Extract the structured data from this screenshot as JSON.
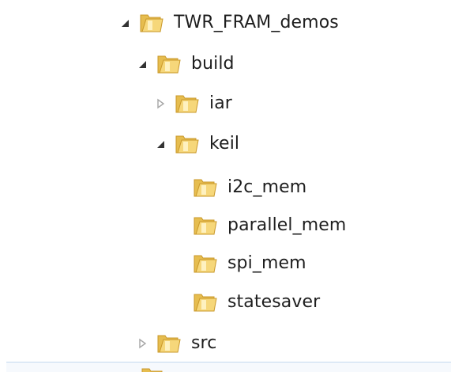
{
  "tree": {
    "nodes": [
      {
        "label": "TWR_FRAM_demos",
        "state": "expanded",
        "icon": "folder-icon"
      },
      {
        "label": "build",
        "state": "expanded",
        "icon": "folder-icon"
      },
      {
        "label": "iar",
        "state": "collapsed",
        "icon": "folder-icon"
      },
      {
        "label": "keil",
        "state": "expanded",
        "icon": "folder-icon"
      },
      {
        "label": "i2c_mem",
        "state": "leaf",
        "icon": "folder-icon"
      },
      {
        "label": "parallel_mem",
        "state": "leaf",
        "icon": "folder-icon"
      },
      {
        "label": "spi_mem",
        "state": "leaf",
        "icon": "folder-icon"
      },
      {
        "label": "statesaver",
        "state": "leaf",
        "icon": "folder-icon"
      },
      {
        "label": "src",
        "state": "collapsed",
        "icon": "folder-icon"
      }
    ]
  },
  "colors": {
    "text": "#1e1e1e",
    "expanded_arrow": "#333333",
    "collapsed_arrow": "#a6a6a6",
    "folder_back": "#e6bd4f",
    "folder_front": "#f6d77a",
    "folder_edge": "#c9982a",
    "selection_bar": "#c4d9f0"
  }
}
